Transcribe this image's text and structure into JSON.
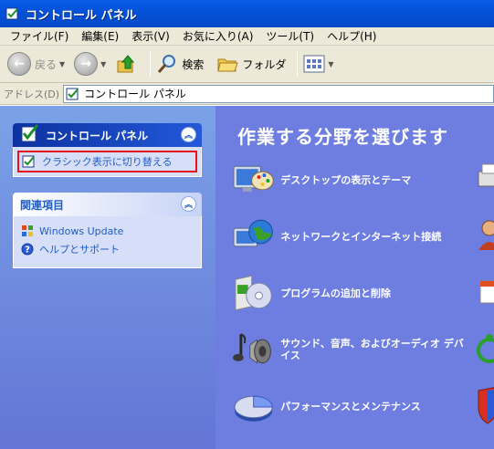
{
  "window": {
    "title": "コントロール パネル"
  },
  "menu": [
    "ファイル(F)",
    "編集(E)",
    "表示(V)",
    "お気に入り(A)",
    "ツール(T)",
    "ヘルプ(H)"
  ],
  "toolbar": {
    "back_label": "戻る",
    "search_label": "検索",
    "folders_label": "フォルダ"
  },
  "address": {
    "label": "アドレス(D)",
    "value": "コントロール パネル"
  },
  "left_pane": {
    "cp_panel": {
      "title": "コントロール パネル",
      "switch_link": "クラシック表示に切り替える"
    },
    "related_panel": {
      "title": "関連項目",
      "links": [
        "Windows Update",
        "ヘルプとサポート"
      ]
    }
  },
  "main": {
    "heading": "作業する分野を選びます",
    "categories": [
      "デスクトップの表示とテーマ",
      "ネットワークとインターネット接続",
      "プログラムの追加と削除",
      "サウンド、音声、およびオーディオ デバイス",
      "パフォーマンスとメンテナンス"
    ]
  },
  "colors": {
    "titlebar": "#0452d8",
    "left_pane": "#7ba2e7",
    "main_bg": "#6d7ee0",
    "link": "#215dc6",
    "highlight": "#e8141c"
  }
}
